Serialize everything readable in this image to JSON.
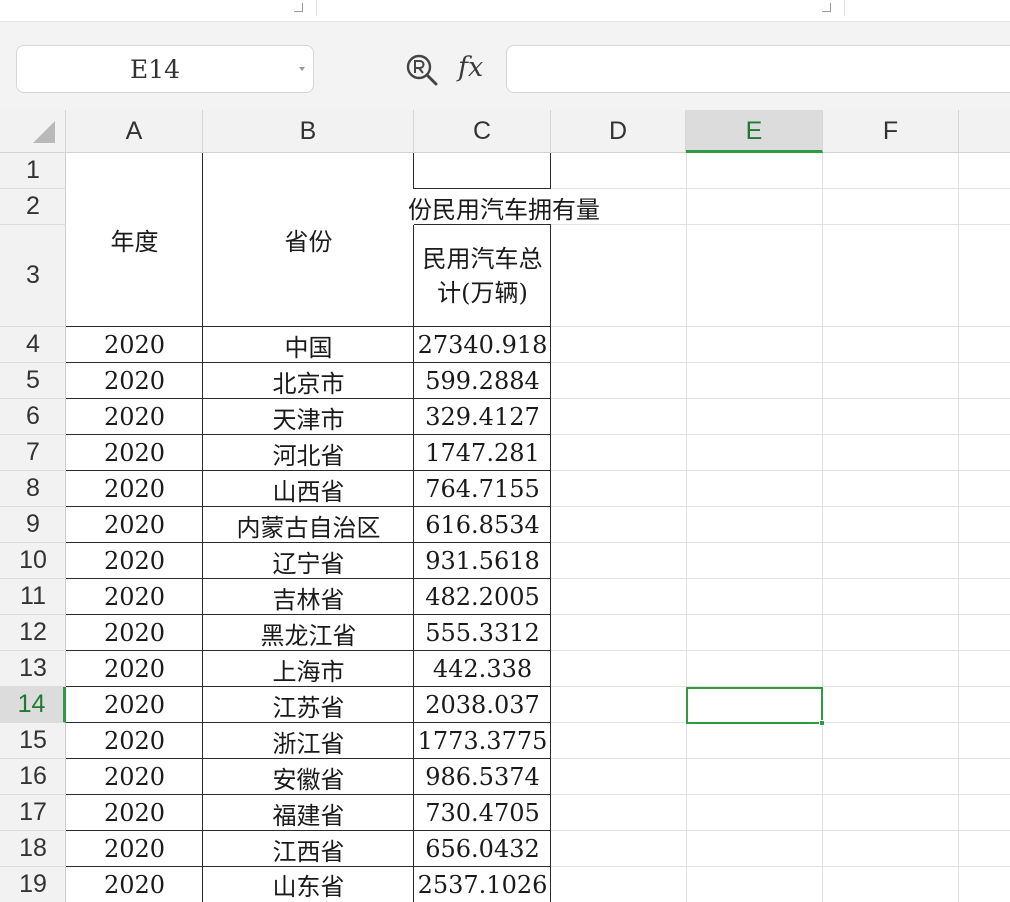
{
  "name_box": {
    "value": "E14"
  },
  "formula_bar": {
    "fx_label": "fx",
    "value": ""
  },
  "columns": [
    "A",
    "B",
    "C",
    "D",
    "E",
    "F"
  ],
  "active_column": "E",
  "active_row": "14",
  "rows": [
    "1",
    "2",
    "3",
    "4",
    "5",
    "6",
    "7",
    "8",
    "9",
    "10",
    "11",
    "12",
    "13",
    "14",
    "15",
    "16",
    "17",
    "18",
    "19"
  ],
  "sheet": {
    "title_partial": "份民用汽车拥有量",
    "header_year": "年度",
    "header_province": "省份",
    "header_cars": "民用汽车总计(万辆)",
    "data_rows": [
      {
        "year": "2020",
        "province": "中国",
        "cars": "27340.918"
      },
      {
        "year": "2020",
        "province": "北京市",
        "cars": "599.2884"
      },
      {
        "year": "2020",
        "province": "天津市",
        "cars": "329.4127"
      },
      {
        "year": "2020",
        "province": "河北省",
        "cars": "1747.281"
      },
      {
        "year": "2020",
        "province": "山西省",
        "cars": "764.7155"
      },
      {
        "year": "2020",
        "province": "内蒙古自治区",
        "cars": "616.8534"
      },
      {
        "year": "2020",
        "province": "辽宁省",
        "cars": "931.5618"
      },
      {
        "year": "2020",
        "province": "吉林省",
        "cars": "482.2005"
      },
      {
        "year": "2020",
        "province": "黑龙江省",
        "cars": "555.3312"
      },
      {
        "year": "2020",
        "province": "上海市",
        "cars": "442.338"
      },
      {
        "year": "2020",
        "province": "江苏省",
        "cars": "2038.037"
      },
      {
        "year": "2020",
        "province": "浙江省",
        "cars": "1773.3775"
      },
      {
        "year": "2020",
        "province": "安徽省",
        "cars": "986.5374"
      },
      {
        "year": "2020",
        "province": "福建省",
        "cars": "730.4705"
      },
      {
        "year": "2020",
        "province": "江西省",
        "cars": "656.0432"
      },
      {
        "year": "2020",
        "province": "山东省",
        "cars": "2537.1026"
      }
    ]
  },
  "colors": {
    "selection": "#2e9b44",
    "header_bg": "#f2f2f2"
  }
}
